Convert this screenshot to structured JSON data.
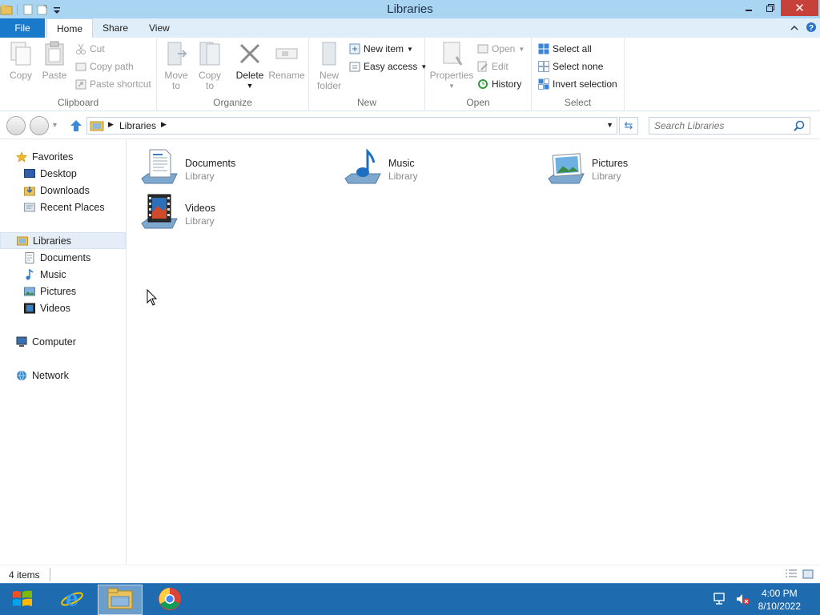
{
  "window": {
    "title": "Libraries"
  },
  "ribbon_tabs": [
    {
      "label": "File"
    },
    {
      "label": "Home"
    },
    {
      "label": "Share"
    },
    {
      "label": "View"
    }
  ],
  "ribbon": {
    "clipboard": {
      "label": "Clipboard",
      "copy": "Copy",
      "paste": "Paste",
      "cut": "Cut",
      "copy_path": "Copy path",
      "paste_shortcut": "Paste shortcut"
    },
    "organize": {
      "label": "Organize",
      "move_to": "Move",
      "move_to2": "to",
      "copy_to": "Copy",
      "copy_to2": "to",
      "delete": "Delete",
      "rename": "Rename"
    },
    "new": {
      "label": "New",
      "new_folder": "New",
      "new_folder2": "folder",
      "new_item": "New item",
      "easy_access": "Easy access"
    },
    "open": {
      "label": "Open",
      "properties": "Properties",
      "open": "Open",
      "edit": "Edit",
      "history": "History"
    },
    "select": {
      "label": "Select",
      "select_all": "Select all",
      "select_none": "Select none",
      "invert_selection": "Invert selection"
    }
  },
  "address": {
    "crumb": "Libraries"
  },
  "search": {
    "placeholder": "Search Libraries"
  },
  "nav_pane": {
    "favorites": "Favorites",
    "favorites_items": [
      "Desktop",
      "Downloads",
      "Recent Places"
    ],
    "libraries": "Libraries",
    "libraries_items": [
      "Documents",
      "Music",
      "Pictures",
      "Videos"
    ],
    "computer": "Computer",
    "network": "Network"
  },
  "libraries": [
    {
      "name": "Documents",
      "type": "Library",
      "icon": "documents-library-icon"
    },
    {
      "name": "Music",
      "type": "Library",
      "icon": "music-library-icon"
    },
    {
      "name": "Pictures",
      "type": "Library",
      "icon": "pictures-library-icon"
    },
    {
      "name": "Videos",
      "type": "Library",
      "icon": "videos-library-icon"
    }
  ],
  "status": {
    "count": "4 items"
  },
  "taskbar": {
    "apps": [
      "start-button",
      "internet-explorer",
      "file-explorer",
      "chrome"
    ],
    "time": "4:00 PM",
    "date": "8/10/2022"
  },
  "colors": {
    "accent": "#1979ca",
    "titlebar": "#a9d4f2",
    "taskbar": "#1e6bb0",
    "close": "#c7413b"
  }
}
